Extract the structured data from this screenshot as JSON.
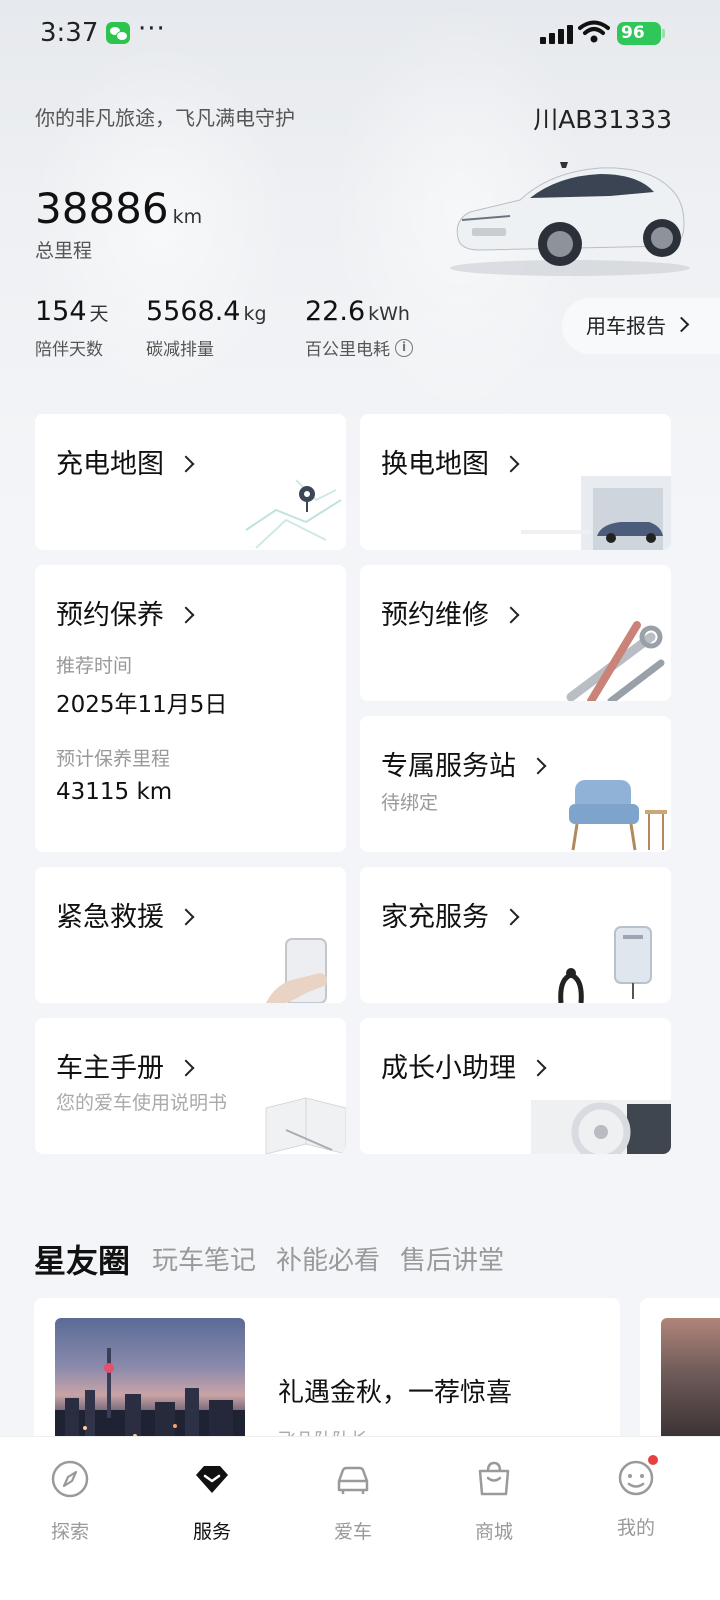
{
  "status_bar": {
    "time": "3:37",
    "dots": "···",
    "battery": "96"
  },
  "header": {
    "slogan": "你的非凡旅途，飞凡满电守护",
    "plate": "川AB31333",
    "mileage_value": "38886",
    "mileage_unit": "km",
    "mileage_label": "总里程"
  },
  "stats": [
    {
      "value": "154",
      "unit": "天",
      "label": "陪伴天数"
    },
    {
      "value": "5568.4",
      "unit": "kg",
      "label": "碳减排量"
    },
    {
      "value": "22.6",
      "unit": "kWh",
      "label": "百公里电耗"
    }
  ],
  "report_button": "用车报告",
  "cards": {
    "charge_map": {
      "title": "充电地图"
    },
    "swap_map": {
      "title": "换电地图"
    },
    "maintenance": {
      "title": "预约保养",
      "recommend_label": "推荐时间",
      "recommend_value": "2025年11月5日",
      "mileage_label": "预计保养里程",
      "mileage_value": "43115 km"
    },
    "repair": {
      "title": "预约维修"
    },
    "service_station": {
      "title": "专属服务站",
      "subtitle": "待绑定"
    },
    "rescue": {
      "title": "紧急救援"
    },
    "home_charge": {
      "title": "家充服务"
    },
    "manual": {
      "title": "车主手册",
      "subtitle": "您的爱车使用说明书"
    },
    "growth": {
      "title": "成长小助理"
    }
  },
  "community": {
    "title": "星友圈",
    "tabs": [
      "玩车笔记",
      "补能必看",
      "售后讲堂"
    ],
    "feed": {
      "title": "礼遇金秋，一荐惊喜",
      "author": "飞凡队队长"
    }
  },
  "tabbar": {
    "items": [
      {
        "label": "探索",
        "icon": "compass-icon"
      },
      {
        "label": "服务",
        "icon": "diamond-icon"
      },
      {
        "label": "爱车",
        "icon": "car-icon"
      },
      {
        "label": "商城",
        "icon": "bag-icon"
      },
      {
        "label": "我的",
        "icon": "profile-icon"
      }
    ],
    "active": "服务"
  }
}
